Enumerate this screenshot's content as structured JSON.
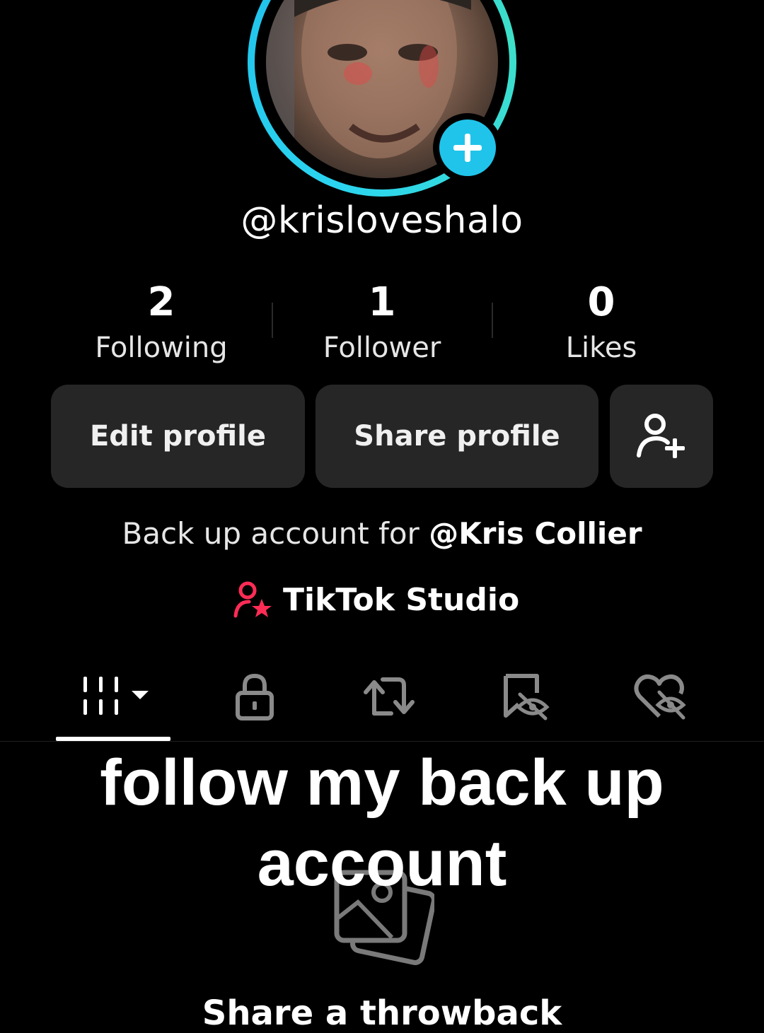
{
  "profile": {
    "username": "@krisloveshalo",
    "stats": [
      {
        "value": "2",
        "label": "Following"
      },
      {
        "value": "1",
        "label": "Follower"
      },
      {
        "value": "0",
        "label": "Likes"
      }
    ],
    "buttons": {
      "edit": "Edit profile",
      "share": "Share profile"
    },
    "bio_prefix": "Back up account for ",
    "bio_mention": "@Kris Collier",
    "studio_label": "TikTok Studio"
  },
  "tabs": [
    {
      "icon": "grid-icon",
      "selected": true
    },
    {
      "icon": "lock-icon",
      "selected": false
    },
    {
      "icon": "repost-icon",
      "selected": false
    },
    {
      "icon": "bookmark-hidden-icon",
      "selected": false
    },
    {
      "icon": "heart-hidden-icon",
      "selected": false
    }
  ],
  "overlay_caption": "follow my back up account",
  "empty_state": {
    "icon": "photos-icon",
    "text": "Share a throwback"
  },
  "colors": {
    "accent": "#20c4ea",
    "studio_icon": "#fe2c55",
    "button_bg": "#262626"
  }
}
